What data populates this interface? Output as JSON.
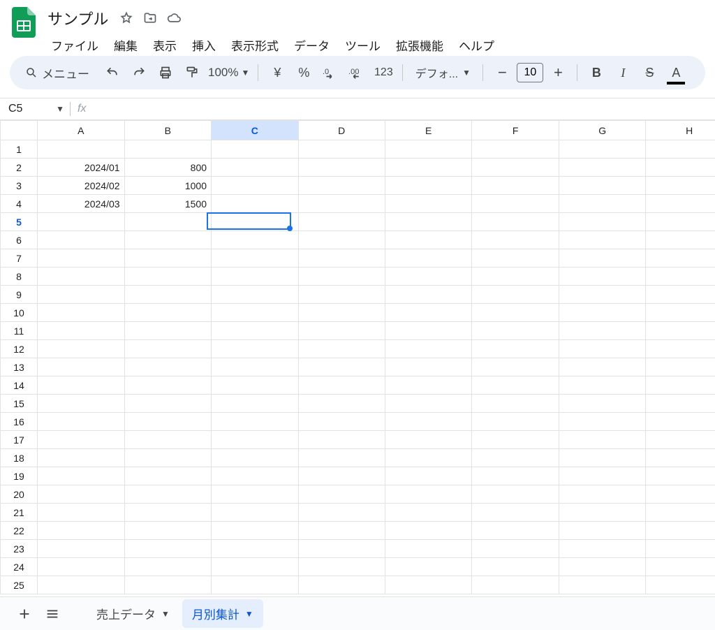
{
  "doc_title": "サンプル",
  "menus": [
    "ファイル",
    "編集",
    "表示",
    "挿入",
    "表示形式",
    "データ",
    "ツール",
    "拡張機能",
    "ヘルプ"
  ],
  "toolbar": {
    "search_label": "メニュー",
    "zoom": "100%",
    "currency_symbol": "¥",
    "percent_symbol": "%",
    "auto_format_label": "123",
    "font_name": "デフォ...",
    "font_size": "10"
  },
  "name_box": "C5",
  "formula": "",
  "columns": [
    "A",
    "B",
    "C",
    "D",
    "E",
    "F",
    "G",
    "H"
  ],
  "row_count": 25,
  "selected_col_index": 2,
  "selected_row_index": 5,
  "cells": {
    "r2": {
      "A": "2024/01",
      "B": "800"
    },
    "r3": {
      "A": "2024/02",
      "B": "1000"
    },
    "r4": {
      "A": "2024/03",
      "B": "1500"
    }
  },
  "sheets": [
    {
      "name": "売上データ",
      "active": false
    },
    {
      "name": "月別集計",
      "active": true
    }
  ]
}
